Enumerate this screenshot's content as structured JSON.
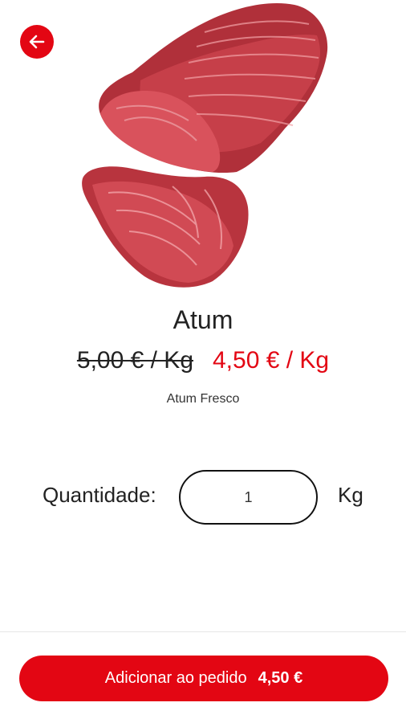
{
  "header": {
    "back_icon": "arrow-left-icon"
  },
  "product": {
    "image": "tuna-steak-image",
    "name": "Atum",
    "old_price": "5,00 € / Kg",
    "new_price": "4,50 € / Kg",
    "description": "Atum Fresco"
  },
  "quantity": {
    "label": "Quantidade:",
    "value": "1",
    "unit": "Kg"
  },
  "footer": {
    "add_label": "Adicionar ao pedido",
    "total": "4,50 €"
  },
  "colors": {
    "accent": "#e30613",
    "text": "#222222"
  }
}
